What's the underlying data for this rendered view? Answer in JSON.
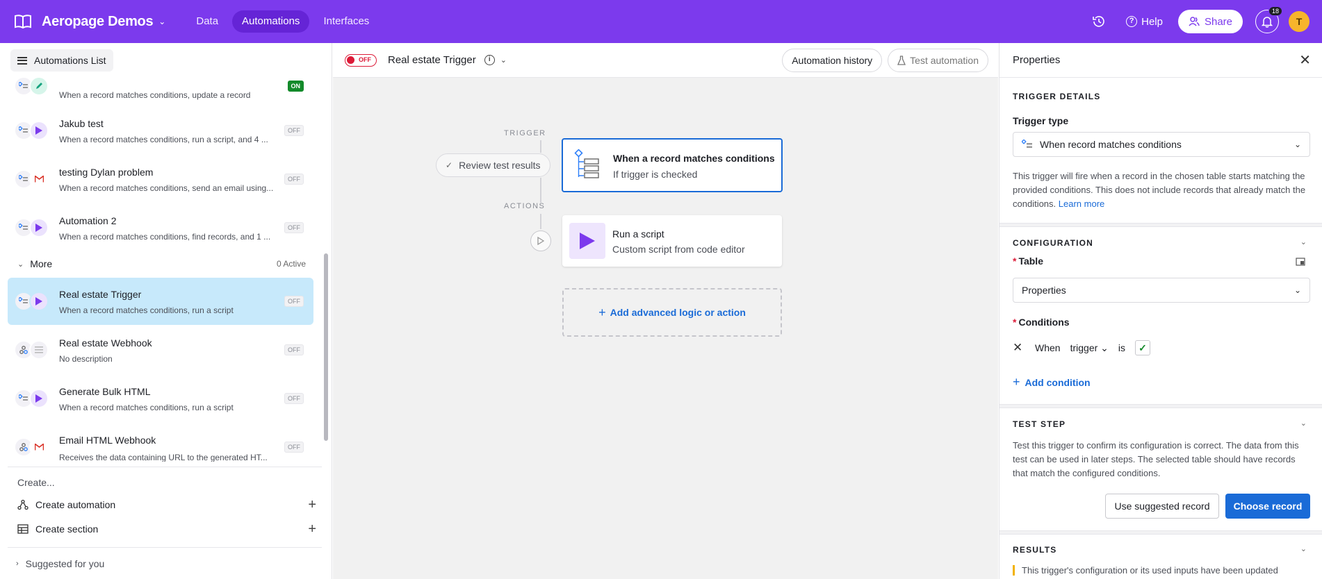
{
  "topbar": {
    "base_name": "Aeropage Demos",
    "nav": [
      "Data",
      "Automations",
      "Interfaces"
    ],
    "active_nav": "Automations",
    "help_label": "Help",
    "share_label": "Share",
    "notification_count": "18",
    "avatar_initial": "T",
    "accent_color": "#7c3aed"
  },
  "sidebar": {
    "list_button_label": "Automations List",
    "automations": [
      {
        "name": "",
        "desc": "When a record matches conditions, update a record",
        "status": "ON",
        "icons": [
          "trigger-icon",
          "pencil-icon"
        ]
      },
      {
        "name": "Jakub test",
        "desc": "When a record matches conditions, run a script, and 4 ...",
        "status": "OFF",
        "icons": [
          "trigger-icon",
          "play-icon"
        ]
      },
      {
        "name": "testing Dylan problem",
        "desc": "When a record matches conditions, send an email using...",
        "status": "OFF",
        "icons": [
          "trigger-icon",
          "gmail-icon"
        ]
      },
      {
        "name": "Automation 2",
        "desc": "When a record matches conditions, find records, and 1 ...",
        "status": "OFF",
        "icons": [
          "trigger-icon",
          "play-icon"
        ]
      }
    ],
    "more_section": {
      "label": "More",
      "count": "0 Active"
    },
    "more_automations": [
      {
        "name": "Real estate Trigger",
        "desc": "When a record matches conditions, run a script",
        "status": "OFF",
        "selected": true,
        "icons": [
          "trigger-icon",
          "play-icon"
        ]
      },
      {
        "name": "Real estate Webhook",
        "desc": "No description",
        "status": "OFF",
        "icons": [
          "webhook-icon",
          "list-icon"
        ]
      },
      {
        "name": "Generate Bulk HTML",
        "desc": "When a record matches conditions, run a script",
        "status": "OFF",
        "icons": [
          "trigger-icon",
          "play-icon"
        ]
      },
      {
        "name": "Email HTML Webhook",
        "desc": "Receives the data containing URL to the generated HT...",
        "status": "OFF",
        "icons": [
          "webhook-icon",
          "gmail-icon"
        ]
      }
    ],
    "create_label": "Create...",
    "create_automation": "Create automation",
    "create_section": "Create section",
    "suggested": "Suggested for you"
  },
  "canvas_header": {
    "toggle_label": "OFF",
    "title": "Real estate Trigger",
    "history_button": "Automation history",
    "test_button": "Test automation"
  },
  "flow": {
    "trigger_label": "TRIGGER",
    "actions_label": "ACTIONS",
    "review_label": "Review test results",
    "trigger_title": "When a record matches conditions",
    "trigger_sub": "If trigger is checked",
    "action_title": "Run a script",
    "action_sub": "Custom script from code editor",
    "add_logic": "Add advanced logic or action"
  },
  "panel": {
    "title": "Properties",
    "trigger_details": "TRIGGER DETAILS",
    "trigger_type_label": "Trigger type",
    "trigger_type_value": "When record matches conditions",
    "trigger_help": "This trigger will fire when a record in the chosen table starts matching the provided conditions. This does not include records that already match the conditions.",
    "learn_more": "Learn more",
    "configuration": "CONFIGURATION",
    "table_label": "Table",
    "table_value": "Properties",
    "conditions_label": "Conditions",
    "cond_when": "When",
    "cond_field": "trigger",
    "cond_op": "is",
    "add_condition": "Add condition",
    "test_step": "TEST STEP",
    "test_help": "Test this trigger to confirm its configuration is correct. The data from this test can be used in later steps. The selected table should have records that match the configured conditions.",
    "use_suggested": "Use suggested record",
    "choose_record": "Choose record",
    "results": "RESULTS",
    "results_warning": "This trigger's configuration or its used inputs have been updated"
  }
}
